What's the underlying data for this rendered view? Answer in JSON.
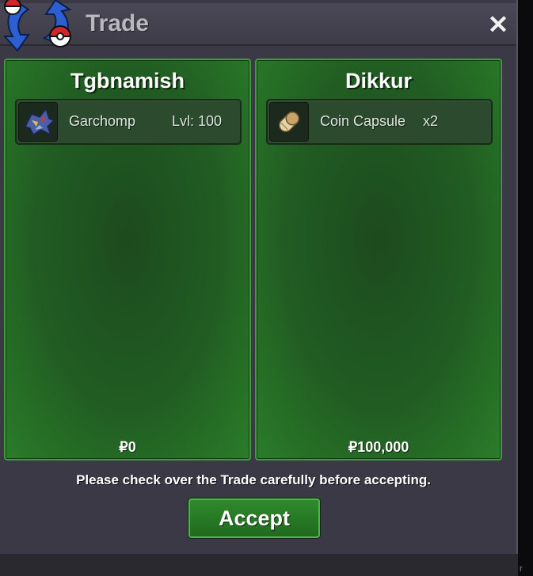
{
  "window": {
    "title": "Trade",
    "close_glyph": "✕"
  },
  "panels": [
    {
      "owner": "Tgbnamish",
      "items": [
        {
          "name": "Garchomp",
          "extra": "Lvl: 100",
          "icon": "garchomp-sprite-icon"
        }
      ],
      "money": "₽0"
    },
    {
      "owner": "Dikkur",
      "items": [
        {
          "name": "Coin Capsule",
          "extra": "x2",
          "icon": "coin-capsule-icon"
        }
      ],
      "money": "₽100,000"
    }
  ],
  "notice": "Please check over the Trade carefully before accepting.",
  "accept_label": "Accept",
  "colors": {
    "panel_green": "#215d22",
    "panel_border": "#3f9b3b",
    "dialog_bg": "#3a3945",
    "accept_bg": "#2f8a2c"
  }
}
